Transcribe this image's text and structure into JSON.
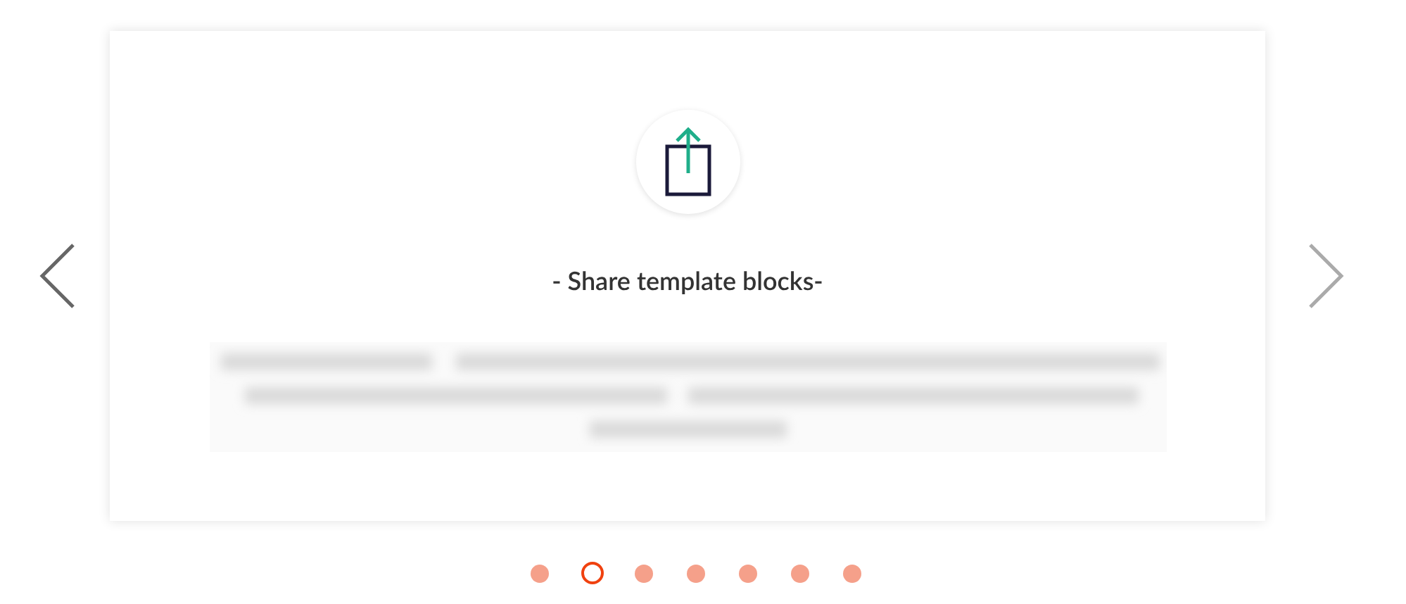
{
  "slide": {
    "title": "- Share template blocks-",
    "description": {
      "kind": "blurred"
    }
  },
  "dots": [
    {
      "selected": false
    },
    {
      "selected": true
    },
    {
      "selected": false
    },
    {
      "selected": false
    },
    {
      "selected": false
    },
    {
      "selected": false
    },
    {
      "selected": false
    }
  ]
}
